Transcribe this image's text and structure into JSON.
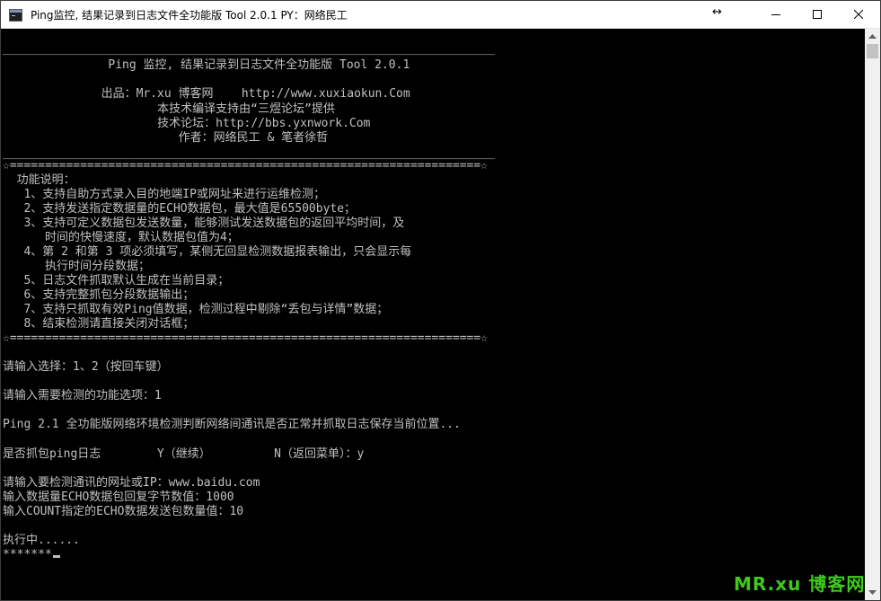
{
  "window": {
    "title": "Ping监控, 结果记录到日志文件全功能版  Tool 2.0.1  PY：网络民工",
    "icon": "console-icon",
    "resize_icon": "↔"
  },
  "titlebar_buttons": [
    {
      "name": "minimize-button",
      "icon": "minimize-icon"
    },
    {
      "name": "maximize-button",
      "icon": "maximize-icon"
    },
    {
      "name": "close-button",
      "icon": "close-icon"
    }
  ],
  "console": {
    "lines": [
      "______________________________________________________________________",
      "               Ping 监控, 结果记录到日志文件全功能版 Tool 2.0.1",
      "",
      "              出品：Mr.xu 博客网    http://www.xuxiaokun.Com",
      "                      本技术编译支持由“三煜论坛”提供",
      "                      技术论坛：http://bbs.yxnwork.Com",
      "                         作者：网络民工 & 笔者徐哲",
      "______________________________________________________________________",
      "☆===================================================================☆",
      "  功能说明：",
      "   1、支持自助方式录入目的地端IP或网址来进行运维检测；",
      "   2、支持发送指定数据量的ECHO数据包，最大值是65500byte；",
      "   3、支持可定义数据包发送数量，能够测试发送数据包的返回平均时间，及",
      "      时间的快慢速度，默认数据包值为4；",
      "   4、第 2 和第 3 项必须填写，某侧无回显检测数据报表输出，只会显示每",
      "      执行时间分段数据；",
      "   5、日志文件抓取默认生成在当前目录；",
      "   6、支持完整抓包分段数据输出；",
      "   7、支持只抓取有效Ping值数据，检测过程中剔除“丢包与详情”数据；",
      "   8、结束检测请直接关闭对话框；",
      "☆===================================================================☆",
      "",
      "请输入选择：1、2（按回车键）",
      "",
      "请输入需要检测的功能选项：1",
      "",
      "Ping 2.1 全功能版网络环境检测判断网络间通讯是否正常并抓取日志保存当前位置...",
      "",
      "是否抓包ping日志        Y（继续）         N（返回菜单）：y",
      "",
      "请输入要检测通讯的网址或IP：www.baidu.com",
      "输入数据量ECHO数据包回复字节数值：1000",
      "输入COUNT指定的ECHO数据发送包数量值：10",
      "",
      "执行中......",
      "*******"
    ]
  },
  "watermark": "MR.xu 博客网",
  "colors": {
    "console_bg": "#000000",
    "console_text": "#c0c0c0",
    "titlebar_bg": "#ffffff",
    "watermark": "#3ec81e"
  }
}
